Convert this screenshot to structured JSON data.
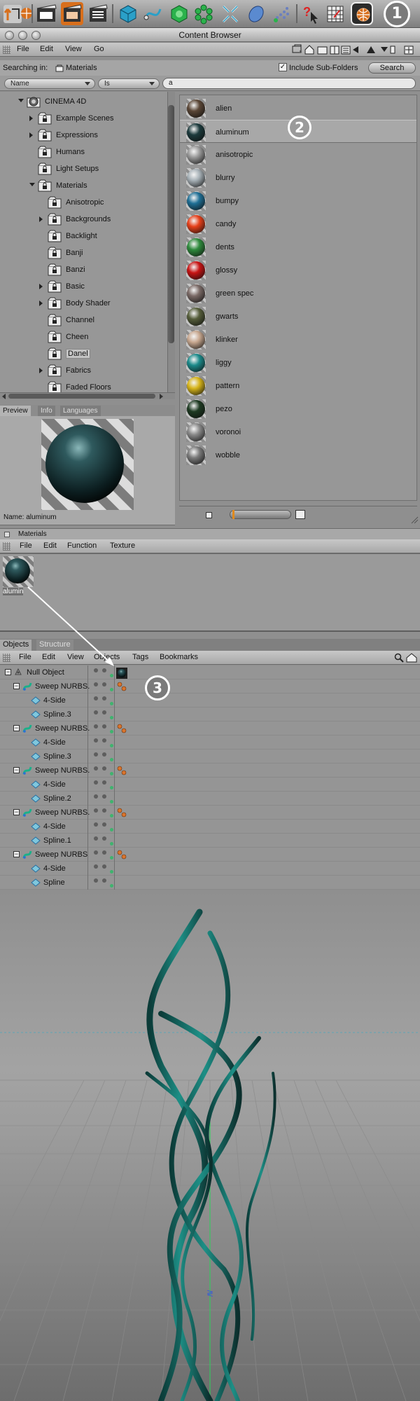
{
  "window": {
    "title": "Content Browser"
  },
  "menu": {
    "file": "File",
    "edit": "Edit",
    "view": "View",
    "go": "Go"
  },
  "search": {
    "searching_in_label": "Searching in:",
    "location": "Materials",
    "include_subfolders_label": "Include Sub-Folders",
    "include_subfolders_checked": true,
    "search_button": "Search",
    "field_select": "Name",
    "operator_select": "Is",
    "query": "a"
  },
  "tree": {
    "items": [
      {
        "label": "CINEMA 4D",
        "level": 0,
        "toggle": "open"
      },
      {
        "label": "Example Scenes",
        "level": 1,
        "toggle": "closed"
      },
      {
        "label": "Expressions",
        "level": 1,
        "toggle": "closed"
      },
      {
        "label": "Humans",
        "level": 1,
        "toggle": "none"
      },
      {
        "label": "Light Setups",
        "level": 1,
        "toggle": "none"
      },
      {
        "label": "Materials",
        "level": 1,
        "toggle": "open"
      },
      {
        "label": "Anisotropic",
        "level": 2,
        "toggle": "none"
      },
      {
        "label": "Backgrounds",
        "level": 2,
        "toggle": "closed"
      },
      {
        "label": "Backlight",
        "level": 2,
        "toggle": "none"
      },
      {
        "label": "Banji",
        "level": 2,
        "toggle": "none"
      },
      {
        "label": "Banzi",
        "level": 2,
        "toggle": "none"
      },
      {
        "label": "Basic",
        "level": 2,
        "toggle": "closed"
      },
      {
        "label": "Body Shader",
        "level": 2,
        "toggle": "closed"
      },
      {
        "label": "Channel",
        "level": 2,
        "toggle": "none"
      },
      {
        "label": "Cheen",
        "level": 2,
        "toggle": "none"
      },
      {
        "label": "Danel",
        "level": 2,
        "toggle": "none",
        "selected": true
      },
      {
        "label": "Fabrics",
        "level": 2,
        "toggle": "closed"
      },
      {
        "label": "Faded Floors",
        "level": 2,
        "toggle": "none"
      }
    ]
  },
  "preview": {
    "tabs": [
      "Preview",
      "Info",
      "Languages"
    ],
    "active_tab": "Preview",
    "name_label": "Name:",
    "name_value": "aluminum"
  },
  "materials": {
    "items": [
      {
        "label": "alien",
        "color": "#5a4636"
      },
      {
        "label": "aluminum",
        "color": "#1c3a3c",
        "selected": true
      },
      {
        "label": "anisotropic",
        "color": "#9a9a9a"
      },
      {
        "label": "blurry",
        "color": "#a8b2b8"
      },
      {
        "label": "bumpy",
        "color": "#1f6f95"
      },
      {
        "label": "candy",
        "color": "#e6401a"
      },
      {
        "label": "dents",
        "color": "#2e8a3c"
      },
      {
        "label": "glossy",
        "color": "#c81414"
      },
      {
        "label": "green spec",
        "color": "#7a6a66"
      },
      {
        "label": "gwarts",
        "color": "#555d3a"
      },
      {
        "label": "klinker",
        "color": "#c8a890"
      },
      {
        "label": "liggy",
        "color": "#1b8a8a"
      },
      {
        "label": "pattern",
        "color": "#d6b41a"
      },
      {
        "label": "pezo",
        "color": "#1e3a22"
      },
      {
        "label": "voronoi",
        "color": "#8a8a8a"
      },
      {
        "label": "wobble",
        "color": "#7a7a7a"
      }
    ]
  },
  "material_manager": {
    "title": "Materials",
    "menu": [
      "File",
      "Edit",
      "Function",
      "Texture"
    ],
    "material_label": "alumin"
  },
  "objects": {
    "tabs": [
      "Objects",
      "Structure"
    ],
    "active_tab": "Objects",
    "menu": [
      "File",
      "Edit",
      "View",
      "Objects",
      "Tags",
      "Bookmarks"
    ],
    "rows": [
      {
        "label": "Null Object",
        "level": 0,
        "icon": "null"
      },
      {
        "label": "Sweep NURBS.",
        "level": 1,
        "icon": "sweep"
      },
      {
        "label": "4-Side",
        "level": 2,
        "icon": "spline"
      },
      {
        "label": "Spline.3",
        "level": 2,
        "icon": "spline"
      },
      {
        "label": "Sweep NURBS.",
        "level": 1,
        "icon": "sweep"
      },
      {
        "label": "4-Side",
        "level": 2,
        "icon": "spline"
      },
      {
        "label": "Spline.3",
        "level": 2,
        "icon": "spline"
      },
      {
        "label": "Sweep NURBS.",
        "level": 1,
        "icon": "sweep"
      },
      {
        "label": "4-Side",
        "level": 2,
        "icon": "spline"
      },
      {
        "label": "Spline.2",
        "level": 2,
        "icon": "spline"
      },
      {
        "label": "Sweep NURBS.",
        "level": 1,
        "icon": "sweep"
      },
      {
        "label": "4-Side",
        "level": 2,
        "icon": "spline"
      },
      {
        "label": "Spline.1",
        "level": 2,
        "icon": "spline"
      },
      {
        "label": "Sweep NURBS",
        "level": 1,
        "icon": "sweep"
      },
      {
        "label": "4-Side",
        "level": 2,
        "icon": "spline"
      },
      {
        "label": "Spline",
        "level": 2,
        "icon": "spline"
      }
    ]
  },
  "callouts": [
    "1",
    "2",
    "3"
  ],
  "colors": {
    "accent": "#d9742c",
    "object_ribbon": "#1d8f86",
    "selection": "#a8a8a8"
  }
}
